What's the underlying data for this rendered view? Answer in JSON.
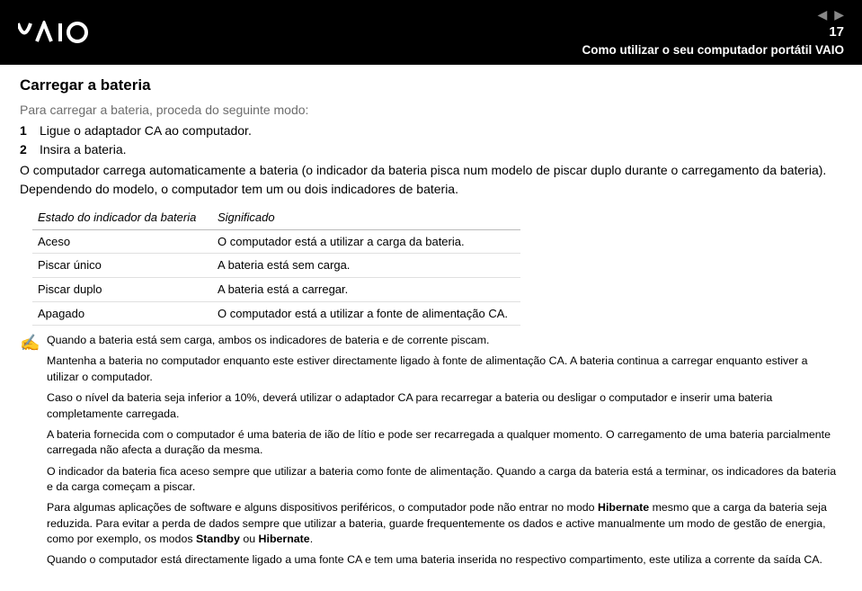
{
  "header": {
    "logo_text": "VAIO",
    "page_number": "17",
    "breadcrumb": "Como utilizar o seu computador portátil VAIO"
  },
  "title": "Carregar a bateria",
  "intro": "Para carregar a bateria, proceda do seguinte modo:",
  "steps": [
    {
      "n": "1",
      "text": "Ligue o adaptador CA ao computador."
    },
    {
      "n": "2",
      "text": "Insira a bateria."
    }
  ],
  "para1": "O computador carrega automaticamente a bateria (o indicador da bateria pisca num modelo de piscar duplo durante o carregamento da bateria).",
  "para2": "Dependendo do modelo, o computador tem um ou dois indicadores de bateria.",
  "table": {
    "head": [
      "Estado do indicador da bateria",
      "Significado"
    ],
    "rows": [
      [
        "Aceso",
        "O computador está a utilizar a carga da bateria."
      ],
      [
        "Piscar único",
        "A bateria está sem carga."
      ],
      [
        "Piscar duplo",
        "A bateria está a carregar."
      ],
      [
        "Apagado",
        "O computador está a utilizar a fonte de alimentação CA."
      ]
    ]
  },
  "note": {
    "p1": "Quando a bateria está sem carga, ambos os indicadores de bateria e de corrente piscam.",
    "p2": "Mantenha a bateria no computador enquanto este estiver directamente ligado à fonte de alimentação CA. A bateria continua a carregar enquanto estiver a utilizar o computador.",
    "p3": "Caso o nível da bateria seja inferior a 10%, deverá utilizar o adaptador CA para recarregar a bateria ou desligar o computador e inserir uma bateria completamente carregada.",
    "p4": "A bateria fornecida com o computador é uma bateria de ião de lítio e pode ser recarregada a qualquer momento. O carregamento de uma bateria parcialmente carregada não afecta a duração da mesma.",
    "p5": "O indicador da bateria fica aceso sempre que utilizar a bateria como fonte de alimentação. Quando a carga da bateria está a terminar, os indicadores da bateria e da carga começam a piscar.",
    "p6a": "Para algumas aplicações de software e alguns dispositivos periféricos, o computador pode não entrar no modo ",
    "p6b": "Hibernate",
    "p6c": " mesmo que a carga da bateria seja reduzida. Para evitar a perda de dados sempre que utilizar a bateria, guarde frequentemente os dados e active manualmente um modo de gestão de energia, como por exemplo, os modos ",
    "p6d": "Standby",
    "p6e": " ou ",
    "p6f": "Hibernate",
    "p6g": ".",
    "p7": "Quando o computador está directamente ligado a uma fonte CA e tem uma bateria inserida no respectivo compartimento, este utiliza a corrente da saída CA."
  }
}
